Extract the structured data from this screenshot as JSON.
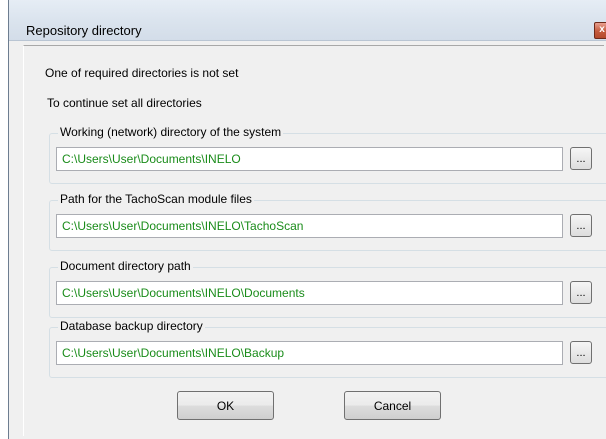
{
  "window": {
    "title": "Repository directory",
    "close_glyph": "x"
  },
  "messages": {
    "line1": "One of required directories is not set",
    "line2": "To continue set all directories"
  },
  "groups": [
    {
      "label": "Working (network) directory of the system",
      "path": "C:\\Users\\User\\Documents\\INELO",
      "browse_label": "..."
    },
    {
      "label": "Path for the TachoScan module files",
      "path": "C:\\Users\\User\\Documents\\INELO\\TachoScan",
      "browse_label": "..."
    },
    {
      "label": "Document directory path",
      "path": "C:\\Users\\User\\Documents\\INELO\\Documents",
      "browse_label": "..."
    },
    {
      "label": "Database backup directory",
      "path": "C:\\Users\\User\\Documents\\INELO\\Backup",
      "browse_label": "..."
    }
  ],
  "buttons": {
    "ok": "OK",
    "cancel": "Cancel"
  },
  "colors": {
    "path_text": "#1a8c1a",
    "close_button": "#c45a3c"
  }
}
